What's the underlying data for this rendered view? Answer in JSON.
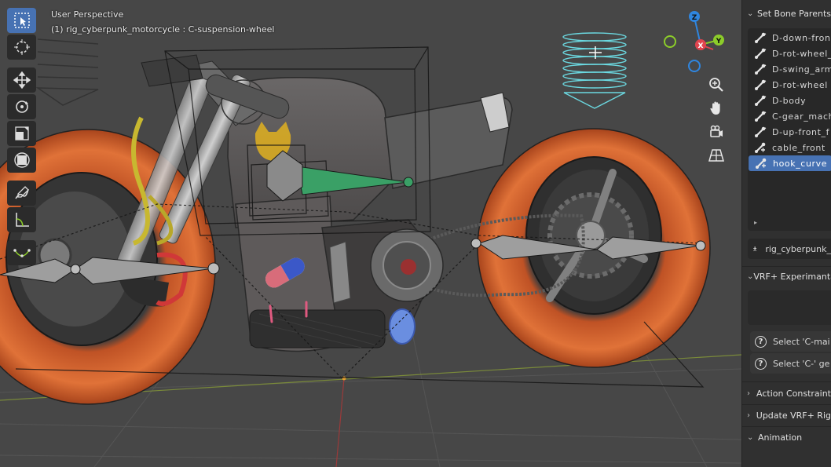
{
  "viewport": {
    "perspective_label": "User Perspective",
    "object_label": "(1) rig_cyberpunk_motorcycle : C-suspension-wheel"
  },
  "toolbar": {
    "tools": [
      "select-box",
      "cursor",
      "move",
      "rotate",
      "scale",
      "transform",
      "annotate",
      "measure",
      "custom-curve"
    ],
    "active": "select-box"
  },
  "gizmo": {
    "z": "Z",
    "y": "Y",
    "x": "X"
  },
  "panel": {
    "set_bone_parents": "Set Bone Parents",
    "bones": [
      {
        "label": "D-down-fron",
        "icon": "bone-icon",
        "selected": false
      },
      {
        "label": "D-rot-wheel_",
        "icon": "bone-icon",
        "selected": false
      },
      {
        "label": "D-swing_arm",
        "icon": "bone-icon",
        "selected": false
      },
      {
        "label": "D-rot-wheel",
        "icon": "bone-icon",
        "selected": false
      },
      {
        "label": "D-body",
        "icon": "bone-icon",
        "selected": false
      },
      {
        "label": "C-gear_mach",
        "icon": "bone-icon",
        "selected": false
      },
      {
        "label": "D-up-front_f",
        "icon": "bone-icon",
        "selected": false
      },
      {
        "label": "cable_front",
        "icon": "bone-constraint-icon",
        "selected": false
      },
      {
        "label": "hook_curve",
        "icon": "bone-constraint-icon",
        "selected": true
      }
    ],
    "rig_name": "rig_cyberpunk_",
    "vrf_experimental": "VRF+ Experimanta",
    "help_rows": [
      "Select 'C-mai",
      "Select 'C-' ge"
    ],
    "action_constraints": "Action Constraint",
    "update_rig": "Update VRF+ Rig",
    "animation": "Animation"
  },
  "colors": {
    "viewport_bg": "#474747",
    "panel_bg": "#303030",
    "selection": "#4772b3",
    "tire_orange": "#d9662f",
    "axis_x": "#e0444e",
    "axis_y": "#8ccc2a",
    "axis_z": "#2f86e0"
  }
}
